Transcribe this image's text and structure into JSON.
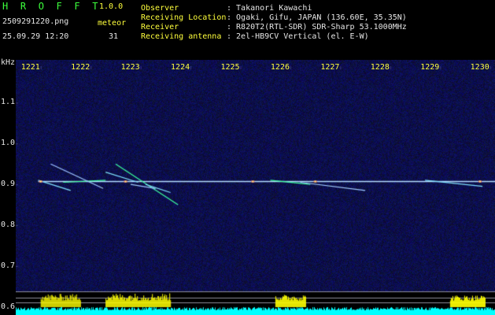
{
  "header": {
    "app_title": "H R O F F T",
    "version": "1.0.0",
    "filename": "2509291220.png",
    "meteor_label": "meteor",
    "datetime": "25.09.29 12:20",
    "meteor_count": "31"
  },
  "info": [
    {
      "label": "Observer",
      "value": ": Takanori Kawachi"
    },
    {
      "label": "Receiving Location",
      "value": ": Ogaki, Gifu, JAPAN (136.60E, 35.35N)"
    },
    {
      "label": "Receiver",
      "value": ": R820T2(RTL-SDR) SDR-Sharp 53.1000MHz"
    },
    {
      "label": "Receiving antenna",
      "value": ": 2el-HB9CV Vertical (el. E-W)"
    }
  ],
  "axis": {
    "y_unit": "kHz",
    "y_ticks": [
      {
        "label": "1.1",
        "value": 1.1
      },
      {
        "label": "1.0",
        "value": 1.0
      },
      {
        "label": "0.9",
        "value": 0.9
      },
      {
        "label": "0.8",
        "value": 0.8
      },
      {
        "label": "0.7",
        "value": 0.7
      },
      {
        "label": "0.6",
        "value": 0.6
      }
    ],
    "x_ticks": [
      "1221",
      "1222",
      "1223",
      "1224",
      "1225",
      "1226",
      "1227",
      "1228",
      "1229",
      "1230"
    ]
  },
  "colors": {
    "label_green": "#3cff3c",
    "tick_yellow": "#ffff3c",
    "background_blue": "#0a0a3a",
    "carrier": "#b4dcff",
    "histogram_yellow": "#ffff00",
    "histogram_cyan": "#00ffff"
  },
  "chart_data": {
    "type": "heatmap",
    "xlim": [
      1220.5,
      1230.1
    ],
    "ylim": [
      0.58,
      1.205
    ],
    "carrier_freq": 0.907,
    "meteor_traces": [
      {
        "t": [
          1220.95,
          1221.6
        ],
        "f": [
          0.91,
          0.885
        ]
      },
      {
        "t": [
          1221.45,
          1222.3
        ],
        "f": [
          0.905,
          0.91
        ]
      },
      {
        "t": [
          1221.2,
          1222.25
        ],
        "f": [
          0.95,
          0.89
        ]
      },
      {
        "t": [
          1222.3,
          1222.95
        ],
        "f": [
          0.93,
          0.905
        ]
      },
      {
        "t": [
          1222.5,
          1223.75
        ],
        "f": [
          0.95,
          0.85
        ]
      },
      {
        "t": [
          1222.8,
          1223.3
        ],
        "f": [
          0.9,
          0.89
        ]
      },
      {
        "t": [
          1223.1,
          1223.6
        ],
        "f": [
          0.9,
          0.88
        ]
      },
      {
        "t": [
          1225.6,
          1226.4
        ],
        "f": [
          0.91,
          0.9
        ]
      },
      {
        "t": [
          1226.2,
          1227.5
        ],
        "f": [
          0.905,
          0.885
        ]
      },
      {
        "t": [
          1228.7,
          1229.85
        ],
        "f": [
          0.91,
          0.895
        ]
      }
    ],
    "bright_spots": [
      1221.0,
      1222.7,
      1225.25,
      1226.5,
      1229.8
    ],
    "histogram_yellow": [
      {
        "t": [
          1221.0,
          1221.8
        ],
        "level": 0.55
      },
      {
        "t": [
          1222.3,
          1223.6
        ],
        "level": 0.6
      },
      {
        "t": [
          1225.7,
          1226.3
        ],
        "level": 0.5
      },
      {
        "t": [
          1229.2,
          1229.9
        ],
        "level": 0.45
      }
    ]
  }
}
